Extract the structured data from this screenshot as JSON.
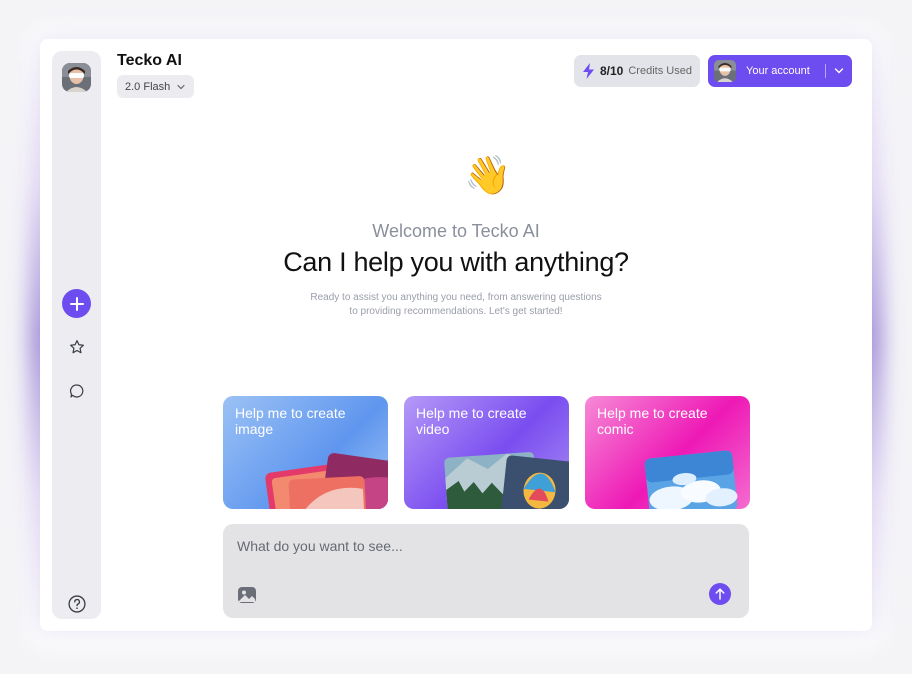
{
  "app": {
    "name": "Tecko AI",
    "model": "2.0 Flash"
  },
  "credits": {
    "value": "8/10",
    "label": "Credits Used"
  },
  "account": {
    "label": "Your account"
  },
  "welcome": {
    "emoji": "👋",
    "line": "Welcome to Tecko AI",
    "headline": "Can I help you with anything?",
    "sub1": "Ready to assist you anything you need, from answering questions",
    "sub2": "to providing recommendations. Let's get started!"
  },
  "cards": [
    {
      "title": "Help me to create image"
    },
    {
      "title": "Help me to create video"
    },
    {
      "title": "Help me to create comic"
    }
  ],
  "prompt": {
    "placeholder": "What do you want to see..."
  },
  "sidebar": {
    "icons": [
      "avatar",
      "plus-icon",
      "star-icon",
      "chat-bubble-icon",
      "help-icon"
    ]
  },
  "colors": {
    "accent": "#6d4cf0",
    "card_image": "#5f96ee",
    "card_video": "#7a4df0",
    "card_comic": "#ee19b6"
  }
}
